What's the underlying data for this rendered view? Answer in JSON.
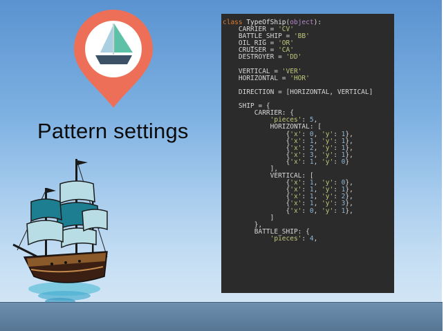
{
  "slide": {
    "title": "Pattern settings",
    "colors": {
      "sky_top": "#5a93d0",
      "sky_bottom": "#d8e9f7",
      "pin": "#ee6f58",
      "sail": "#5dc1a7",
      "hull": "#3b5166",
      "code_bg": "#2b2b2b"
    }
  },
  "code": {
    "language": "python",
    "lines": [
      [
        [
          "kw",
          "class "
        ],
        [
          "cls",
          "TypeOfShip"
        ],
        [
          "p",
          "("
        ],
        [
          "bi",
          "object"
        ],
        [
          "p",
          "):"
        ]
      ],
      [
        [
          "p",
          "    CARRIER = "
        ],
        [
          "str",
          "'CV'"
        ]
      ],
      [
        [
          "p",
          "    BATTLE_SHIP = "
        ],
        [
          "str",
          "'BB'"
        ]
      ],
      [
        [
          "p",
          "    OIL_RIG = "
        ],
        [
          "str",
          "'OR'"
        ]
      ],
      [
        [
          "p",
          "    CRUISER = "
        ],
        [
          "str",
          "'CA'"
        ]
      ],
      [
        [
          "p",
          "    DESTROYER = "
        ],
        [
          "str",
          "'DD'"
        ]
      ],
      [
        [
          "p",
          ""
        ]
      ],
      [
        [
          "p",
          "    VERTICAL = "
        ],
        [
          "str",
          "'VER'"
        ]
      ],
      [
        [
          "p",
          "    HORIZONTAL = "
        ],
        [
          "str",
          "'HOR'"
        ]
      ],
      [
        [
          "p",
          ""
        ]
      ],
      [
        [
          "p",
          "    DIRECTION = [HORIZONTAL, VERTICAL]"
        ]
      ],
      [
        [
          "p",
          ""
        ]
      ],
      [
        [
          "p",
          "    SHIP = {"
        ]
      ],
      [
        [
          "p",
          "        CARRIER: {"
        ]
      ],
      [
        [
          "p",
          "            "
        ],
        [
          "str",
          "'pieces'"
        ],
        [
          "p",
          ": "
        ],
        [
          "num",
          "5"
        ],
        [
          "p",
          ","
        ]
      ],
      [
        [
          "p",
          "            HORIZONTAL: ["
        ]
      ],
      [
        [
          "p",
          "                {"
        ],
        [
          "str",
          "'x'"
        ],
        [
          "p",
          ": "
        ],
        [
          "num",
          "0"
        ],
        [
          "p",
          ", "
        ],
        [
          "str",
          "'y'"
        ],
        [
          "p",
          ": "
        ],
        [
          "num",
          "1"
        ],
        [
          "p",
          "},"
        ]
      ],
      [
        [
          "p",
          "                {"
        ],
        [
          "str",
          "'x'"
        ],
        [
          "p",
          ": "
        ],
        [
          "num",
          "1"
        ],
        [
          "p",
          ", "
        ],
        [
          "str",
          "'y'"
        ],
        [
          "p",
          ": "
        ],
        [
          "num",
          "1"
        ],
        [
          "p",
          "},"
        ]
      ],
      [
        [
          "p",
          "                {"
        ],
        [
          "str",
          "'x'"
        ],
        [
          "p",
          ": "
        ],
        [
          "num",
          "2"
        ],
        [
          "p",
          ", "
        ],
        [
          "str",
          "'y'"
        ],
        [
          "p",
          ": "
        ],
        [
          "num",
          "1"
        ],
        [
          "p",
          "},"
        ]
      ],
      [
        [
          "p",
          "                {"
        ],
        [
          "str",
          "'x'"
        ],
        [
          "p",
          ": "
        ],
        [
          "num",
          "3"
        ],
        [
          "p",
          ", "
        ],
        [
          "str",
          "'y'"
        ],
        [
          "p",
          ": "
        ],
        [
          "num",
          "1"
        ],
        [
          "p",
          "},"
        ]
      ],
      [
        [
          "p",
          "                {"
        ],
        [
          "str",
          "'x'"
        ],
        [
          "p",
          ": "
        ],
        [
          "num",
          "1"
        ],
        [
          "p",
          ", "
        ],
        [
          "str",
          "'y'"
        ],
        [
          "p",
          ": "
        ],
        [
          "num",
          "0"
        ],
        [
          "p",
          "}"
        ]
      ],
      [
        [
          "p",
          "            ],"
        ]
      ],
      [
        [
          "p",
          "            VERTICAL: ["
        ]
      ],
      [
        [
          "p",
          "                {"
        ],
        [
          "str",
          "'x'"
        ],
        [
          "p",
          ": "
        ],
        [
          "num",
          "1"
        ],
        [
          "p",
          ", "
        ],
        [
          "str",
          "'y'"
        ],
        [
          "p",
          ": "
        ],
        [
          "num",
          "0"
        ],
        [
          "p",
          "},"
        ]
      ],
      [
        [
          "p",
          "                {"
        ],
        [
          "str",
          "'x'"
        ],
        [
          "p",
          ": "
        ],
        [
          "num",
          "1"
        ],
        [
          "p",
          ", "
        ],
        [
          "str",
          "'y'"
        ],
        [
          "p",
          ": "
        ],
        [
          "num",
          "1"
        ],
        [
          "p",
          "},"
        ]
      ],
      [
        [
          "p",
          "                {"
        ],
        [
          "str",
          "'x'"
        ],
        [
          "p",
          ": "
        ],
        [
          "num",
          "1"
        ],
        [
          "p",
          ", "
        ],
        [
          "str",
          "'y'"
        ],
        [
          "p",
          ": "
        ],
        [
          "num",
          "2"
        ],
        [
          "p",
          "},"
        ]
      ],
      [
        [
          "p",
          "                {"
        ],
        [
          "str",
          "'x'"
        ],
        [
          "p",
          ": "
        ],
        [
          "num",
          "1"
        ],
        [
          "p",
          ", "
        ],
        [
          "str",
          "'y'"
        ],
        [
          "p",
          ": "
        ],
        [
          "num",
          "3"
        ],
        [
          "p",
          "},"
        ]
      ],
      [
        [
          "p",
          "                {"
        ],
        [
          "str",
          "'x'"
        ],
        [
          "p",
          ": "
        ],
        [
          "num",
          "0"
        ],
        [
          "p",
          ", "
        ],
        [
          "str",
          "'y'"
        ],
        [
          "p",
          ": "
        ],
        [
          "num",
          "1"
        ],
        [
          "p",
          "},"
        ]
      ],
      [
        [
          "p",
          "            ]"
        ]
      ],
      [
        [
          "p",
          "        },"
        ]
      ],
      [
        [
          "p",
          "        BATTLE_SHIP: {"
        ]
      ],
      [
        [
          "p",
          "            "
        ],
        [
          "str",
          "'pieces'"
        ],
        [
          "p",
          ": "
        ],
        [
          "num",
          "4"
        ],
        [
          "p",
          ","
        ]
      ]
    ]
  }
}
